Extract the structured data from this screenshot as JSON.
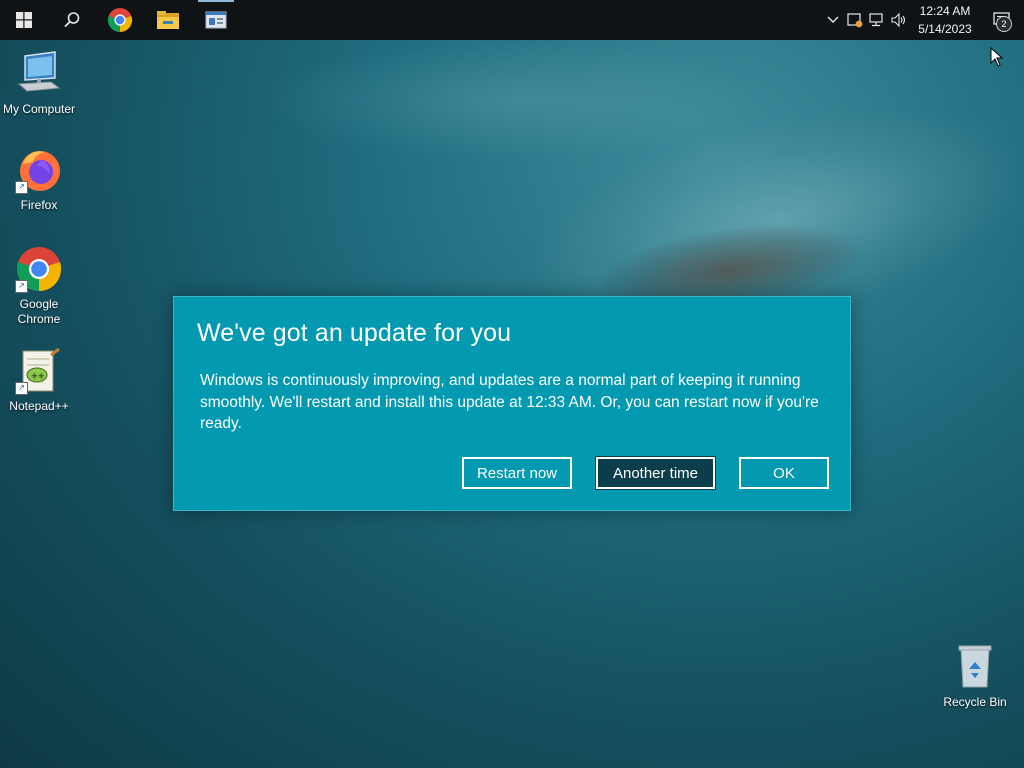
{
  "taskbar": {
    "start_icon": "windows-logo-icon",
    "search_icon": "search-icon",
    "pinned": [
      {
        "name": "chrome-icon"
      },
      {
        "name": "file-explorer-icon"
      },
      {
        "name": "app-window-icon"
      }
    ],
    "tray": {
      "chevron_icon": "chevron-up-icon",
      "security_icon": "security-warning-icon",
      "network_icon": "network-icon",
      "volume_icon": "volume-icon",
      "time": "12:24 AM",
      "date": "5/14/2023",
      "notification_count": "2"
    }
  },
  "desktop": {
    "icons": [
      {
        "label": "My Computer",
        "icon": "computer-icon"
      },
      {
        "label": "Firefox",
        "icon": "firefox-icon"
      },
      {
        "label": "Google Chrome",
        "icon": "chrome-icon"
      },
      {
        "label": "Notepad++",
        "icon": "notepad-plus-plus-icon"
      },
      {
        "label": "Recycle Bin",
        "icon": "recycle-bin-icon"
      }
    ]
  },
  "dialog": {
    "title": "We've got an update for you",
    "body": "Windows is continuously improving, and updates are a normal part of keeping it running smoothly. We'll restart and install this update at 12:33 AM. Or, you can restart now if you're ready.",
    "buttons": {
      "restart_now": "Restart now",
      "another_time": "Another time",
      "ok": "OK"
    }
  },
  "colors": {
    "dialog_background": "#0299b1",
    "taskbar_background": "#101316",
    "focused_button": "#0b3e4a"
  }
}
